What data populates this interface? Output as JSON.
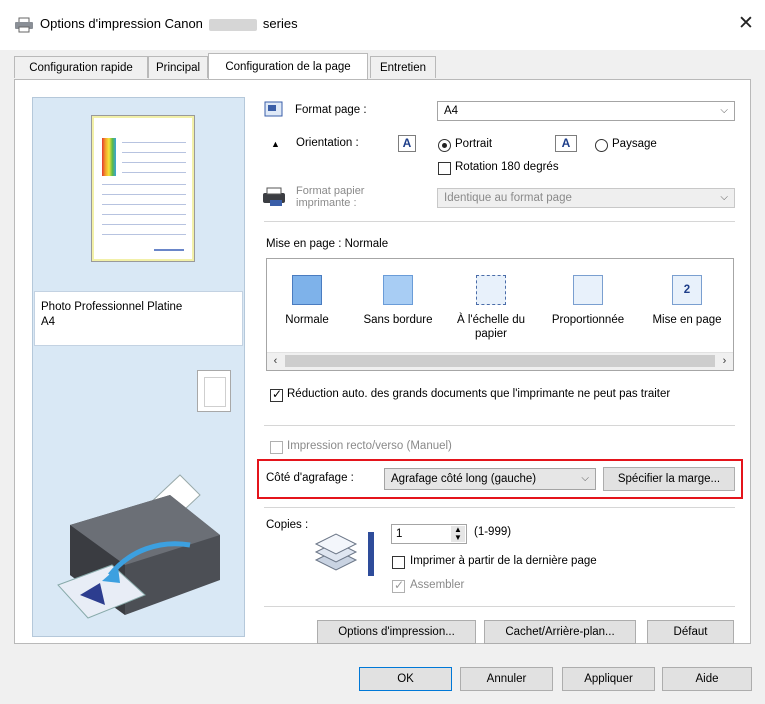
{
  "window": {
    "title_prefix": "Options d'impression Canon",
    "title_suffix": "series",
    "close_label": "✕"
  },
  "tabs": [
    {
      "label": "Configuration rapide"
    },
    {
      "label": "Principal"
    },
    {
      "label": "Configuration de la page",
      "active": true
    },
    {
      "label": "Entretien"
    }
  ],
  "preview": {
    "media_line1": "Photo Professionnel Platine",
    "media_line2": "A4"
  },
  "page_setup": {
    "format_page_label": "Format page :",
    "format_page_value": "A4",
    "orientation_label": "Orientation :",
    "portrait_label": "Portrait",
    "landscape_label": "Paysage",
    "rotation_label": "Rotation 180 degrés",
    "format_papier_label_1": "Format papier",
    "format_papier_label_2": "imprimante :",
    "format_papier_value": "Identique au format page",
    "mise_en_page_label": "Mise en page :  Normale",
    "layout_items": [
      {
        "label": "Normale"
      },
      {
        "label": "Sans bordure"
      },
      {
        "label": "À l'échelle du papier"
      },
      {
        "label": "Proportionnée"
      },
      {
        "label": "Mise en page"
      }
    ],
    "reduction_label": "Réduction auto. des grands documents que l'imprimante ne peut pas traiter",
    "duplex_label": "Impression recto/verso (Manuel)",
    "staple_label": "Côté d'agrafage :",
    "staple_value": "Agrafage côté long (gauche)",
    "margin_button": "Spécifier la marge...",
    "copies_label": "Copies :",
    "copies_value": "1",
    "copies_range": "(1-999)",
    "reverse_label": "Imprimer à partir de la dernière page",
    "collate_label": "Assembler",
    "options_button": "Options d'impression...",
    "stamp_button": "Cachet/Arrière-plan...",
    "default_button": "Défaut"
  },
  "footer": {
    "ok": "OK",
    "cancel": "Annuler",
    "apply": "Appliquer",
    "help": "Aide"
  }
}
